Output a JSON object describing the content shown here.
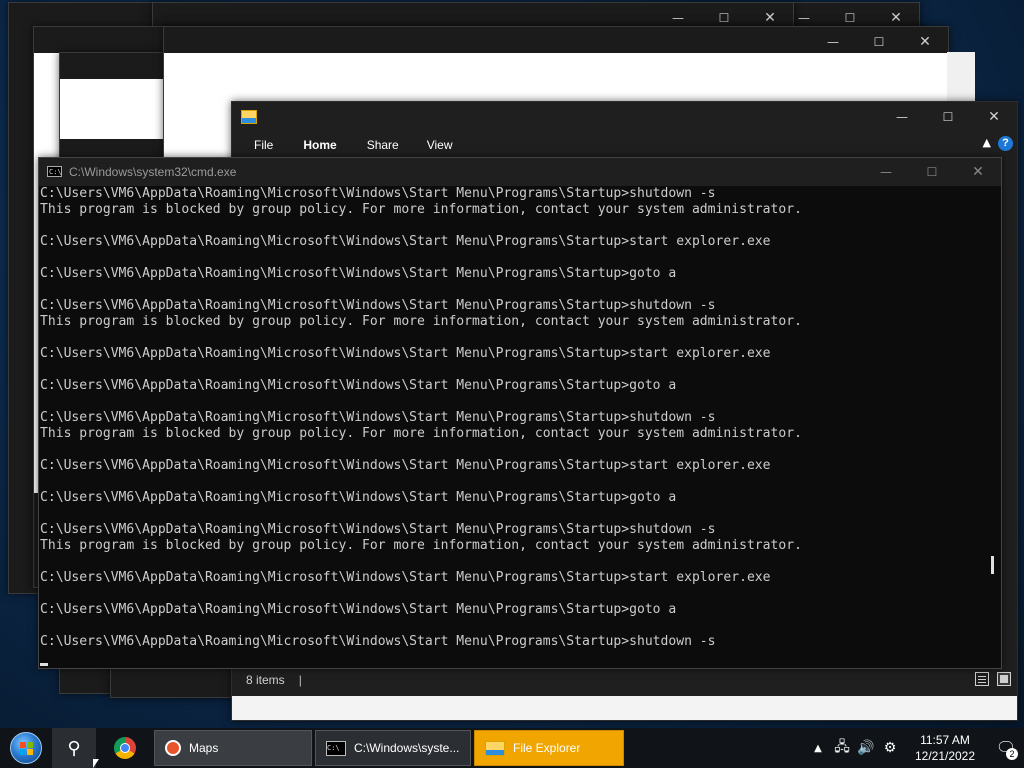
{
  "cmd": {
    "title": "C:\\Windows\\system32\\cmd.exe",
    "lines": [
      "C:\\Users\\VM6\\AppData\\Roaming\\Microsoft\\Windows\\Start Menu\\Programs\\Startup>shutdown -s",
      "This program is blocked by group policy. For more information, contact your system administrator.",
      "",
      "C:\\Users\\VM6\\AppData\\Roaming\\Microsoft\\Windows\\Start Menu\\Programs\\Startup>start explorer.exe",
      "",
      "C:\\Users\\VM6\\AppData\\Roaming\\Microsoft\\Windows\\Start Menu\\Programs\\Startup>goto a",
      "",
      "C:\\Users\\VM6\\AppData\\Roaming\\Microsoft\\Windows\\Start Menu\\Programs\\Startup>shutdown -s",
      "This program is blocked by group policy. For more information, contact your system administrator.",
      "",
      "C:\\Users\\VM6\\AppData\\Roaming\\Microsoft\\Windows\\Start Menu\\Programs\\Startup>start explorer.exe",
      "",
      "C:\\Users\\VM6\\AppData\\Roaming\\Microsoft\\Windows\\Start Menu\\Programs\\Startup>goto a",
      "",
      "C:\\Users\\VM6\\AppData\\Roaming\\Microsoft\\Windows\\Start Menu\\Programs\\Startup>shutdown -s",
      "This program is blocked by group policy. For more information, contact your system administrator.",
      "",
      "C:\\Users\\VM6\\AppData\\Roaming\\Microsoft\\Windows\\Start Menu\\Programs\\Startup>start explorer.exe",
      "",
      "C:\\Users\\VM6\\AppData\\Roaming\\Microsoft\\Windows\\Start Menu\\Programs\\Startup>goto a",
      "",
      "C:\\Users\\VM6\\AppData\\Roaming\\Microsoft\\Windows\\Start Menu\\Programs\\Startup>shutdown -s",
      "This program is blocked by group policy. For more information, contact your system administrator.",
      "",
      "C:\\Users\\VM6\\AppData\\Roaming\\Microsoft\\Windows\\Start Menu\\Programs\\Startup>start explorer.exe",
      "",
      "C:\\Users\\VM6\\AppData\\Roaming\\Microsoft\\Windows\\Start Menu\\Programs\\Startup>goto a",
      "",
      "C:\\Users\\VM6\\AppData\\Roaming\\Microsoft\\Windows\\Start Menu\\Programs\\Startup>shutdown -s"
    ]
  },
  "explorer": {
    "tabs": [
      "File",
      "Home",
      "Share",
      "View"
    ],
    "active_tab": "Home",
    "status_items": "8 items",
    "help_glyph": "?"
  },
  "caption": {
    "minimize": "—",
    "maximize": "☐",
    "close": "✕"
  },
  "taskbar": {
    "tasks": [
      {
        "label": "Maps",
        "icon": "maps-icon"
      },
      {
        "label": "C:\\Windows\\syste...",
        "icon": "cmd-icon"
      },
      {
        "label": "File Explorer",
        "icon": "folder-icon"
      }
    ],
    "time": "11:57 AM",
    "date": "12/21/2022",
    "notification_count": "2"
  },
  "colors": {
    "console_text": "#cccccc",
    "console_bg": "#0c0c0c",
    "explorer_task_active": "#f0a500",
    "help_blue": "#1e78d7"
  }
}
